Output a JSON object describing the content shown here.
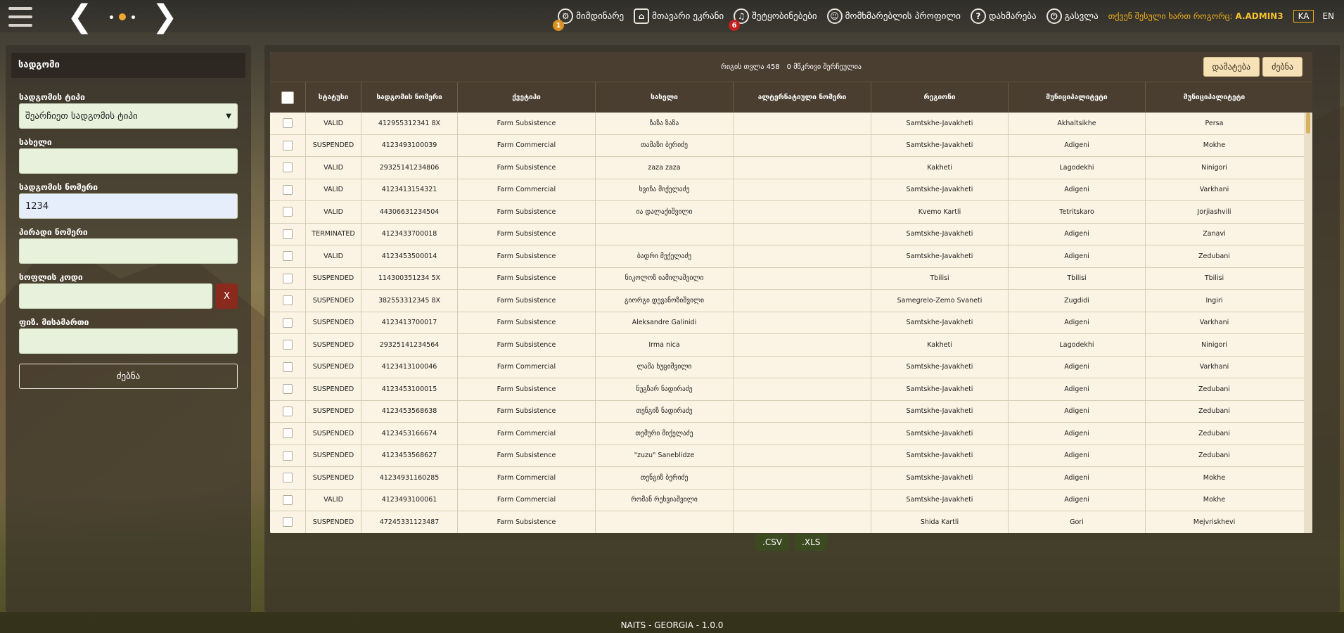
{
  "topbar": {
    "nav": [
      {
        "label": "მიმდინარე",
        "icon": "running-icon",
        "badge": "1"
      },
      {
        "label": "მთავარი ეკრანი",
        "icon": "house-icon",
        "badge": ""
      },
      {
        "label": "შეტყობინებები",
        "icon": "bell-icon",
        "badge": "6"
      },
      {
        "label": "მომხმარებლის პროფილი",
        "icon": "user-icon",
        "badge": ""
      },
      {
        "label": "დახმარება",
        "icon": "help-icon",
        "badge": ""
      },
      {
        "label": "გასვლა",
        "icon": "power-icon",
        "badge": ""
      }
    ],
    "user_prefix": "თქვენ შესული ხართ როგორც:",
    "user_name": "A.ADMIN3",
    "lang_ka": "KA",
    "lang_en": "EN"
  },
  "filter": {
    "title": "სადგომი",
    "type_label": "სადგომის ტიპი",
    "type_value": "შეარჩიეთ სადგომის ტიპი",
    "name_label": "სახელი",
    "name_value": "",
    "number_label": "სადგომის ნომერი",
    "number_value": "1234",
    "personal_label": "პირადი ნომერი",
    "personal_value": "",
    "village_label": "სოფლის კოდი",
    "village_value": "",
    "clear_label": "X",
    "address_label": "ფიზ. მისამართი",
    "address_value": "",
    "search_label": "ძებნა"
  },
  "table": {
    "record_count": "რიგის თვლა 458",
    "selected_count": "0 მწკრივი შერჩეულია",
    "add_label": "დამატება",
    "search_label": "ძებნა",
    "headers": [
      "სტატუსი",
      "სადგომის ნომერი",
      "ქვეტიპი",
      "სახელი",
      "ალტერნატიული ნომერი",
      "რეგიონი",
      "მუნიციპალიტეტი",
      "მუნიციპალიტეტი"
    ],
    "rows": [
      [
        "VALID",
        "412955312341 8X",
        "Farm Subsistence",
        "ზაზა ზაზა",
        "",
        "Samtskhe-Javakheti",
        "Akhaltsikhe",
        "Persa"
      ],
      [
        "SUSPENDED",
        "4123493100039",
        "Farm Commercial",
        "თამაზი ბერიძე",
        "",
        "Samtskhe-Javakheti",
        "Adigeni",
        "Mokhe"
      ],
      [
        "VALID",
        "29325141234806",
        "Farm Subsistence",
        "zaza zaza",
        "",
        "Kakheti",
        "Lagodekhi",
        "Ninigori"
      ],
      [
        "VALID",
        "4123413154321",
        "Farm Commercial",
        "ხვიჩა მიქელაძე",
        "",
        "Samtskhe-Javakheti",
        "Adigeni",
        "Varkhani"
      ],
      [
        "VALID",
        "44306631234504",
        "Farm Subsistence",
        "ია დალაქიშვილი",
        "",
        "Kvemo Kartli",
        "Tetritskaro",
        "Jorjiashvili"
      ],
      [
        "TERMINATED",
        "4123433700018",
        "Farm Subsistence",
        "",
        "",
        "Samtskhe-Javakheti",
        "Adigeni",
        "Zanavi"
      ],
      [
        "VALID",
        "4123453500014",
        "Farm Subsistence",
        "ბადრი მექელაძე",
        "",
        "Samtskhe-Javakheti",
        "Adigeni",
        "Zedubani"
      ],
      [
        "SUSPENDED",
        "114300351234 5X",
        "Farm Subsistence",
        "ნიკოლოზ იამილაშვილი",
        "",
        "Tbilisi",
        "Tbilisi",
        "Tbilisi"
      ],
      [
        "SUSPENDED",
        "382553312345 8X",
        "Farm Subsistence",
        "გიორგი დევანოზიშვილი",
        "",
        "Samegrelo-Zemo Svaneti",
        "Zugdidi",
        "Ingiri"
      ],
      [
        "SUSPENDED",
        "4123413700017",
        "Farm Subsistence",
        "Aleksandre Galinidi",
        "",
        "Samtskhe-Javakheti",
        "Adigeni",
        "Varkhani"
      ],
      [
        "SUSPENDED",
        "29325141234564",
        "Farm Subsistence",
        "Irma nica",
        "",
        "Kakheti",
        "Lagodekhi",
        "Ninigori"
      ],
      [
        "SUSPENDED",
        "4123413100046",
        "Farm Commercial",
        "ლაშა ხუციშვილი",
        "",
        "Samtskhe-Javakheti",
        "Adigeni",
        "Varkhani"
      ],
      [
        "SUSPENDED",
        "4123453100015",
        "Farm Subsistence",
        "ნუგზარ ნადირაძე",
        "",
        "Samtskhe-Javakheti",
        "Adigeni",
        "Zedubani"
      ],
      [
        "SUSPENDED",
        "4123453568638",
        "Farm Subsistence",
        "თენგიზ ნადირაძე",
        "",
        "Samtskhe-Javakheti",
        "Adigeni",
        "Zedubani"
      ],
      [
        "SUSPENDED",
        "4123453166674",
        "Farm Commercial",
        "თემური მიქელაძე",
        "",
        "Samtskhe-Javakheti",
        "Adigeni",
        "Zedubani"
      ],
      [
        "SUSPENDED",
        "4123453568627",
        "Farm Subsistence",
        "\"zuzu\" Saneblidze",
        "",
        "Samtskhe-Javakheti",
        "Adigeni",
        "Zedubani"
      ],
      [
        "SUSPENDED",
        "41234931160285",
        "Farm Commercial",
        "თენგიზ ბერიძე",
        "",
        "Samtskhe-Javakheti",
        "Adigeni",
        "Mokhe"
      ],
      [
        "VALID",
        "4123493100061",
        "Farm Commercial",
        "რომან რეხვიაშვილი",
        "",
        "Samtskhe-Javakheti",
        "Adigeni",
        "Mokhe"
      ],
      [
        "SUSPENDED",
        "47245331123487",
        "Farm Subsistence",
        "",
        "",
        "Shida Kartli",
        "Gori",
        "Mejvriskhevi"
      ]
    ]
  },
  "export": {
    "csv": ".CSV",
    "xls": ".XLS"
  },
  "footer": {
    "text": "NAITS - GEORGIA - 1.0.0"
  }
}
